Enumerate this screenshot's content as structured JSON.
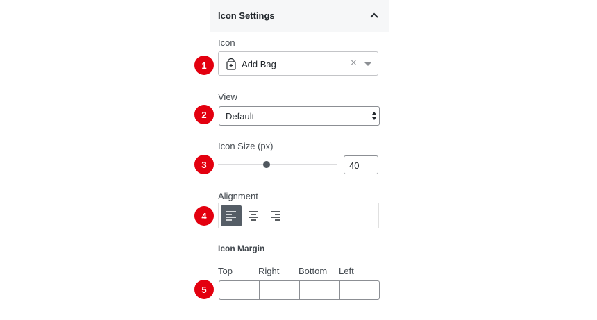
{
  "panel": {
    "title": "Icon Settings"
  },
  "badges": [
    "1",
    "2",
    "3",
    "4",
    "5"
  ],
  "icon_field": {
    "label": "Icon",
    "value": "Add Bag",
    "clear": "×"
  },
  "view_field": {
    "label": "View",
    "value": "Default",
    "options": [
      "Default"
    ]
  },
  "size_field": {
    "label": "Icon Size (px)",
    "value": "40",
    "slider_fraction": 0.4
  },
  "alignment_field": {
    "label": "Alignment",
    "options": [
      "left",
      "center",
      "right"
    ],
    "selected": "left"
  },
  "margin": {
    "title": "Icon Margin",
    "labels": {
      "top": "Top",
      "right": "Right",
      "bottom": "Bottom",
      "left": "Left"
    },
    "values": {
      "top": "",
      "right": "",
      "bottom": "",
      "left": ""
    }
  },
  "colors": {
    "badge": "#e3000f",
    "active_button": "#555d66",
    "header_bg": "#f6f7f8"
  }
}
